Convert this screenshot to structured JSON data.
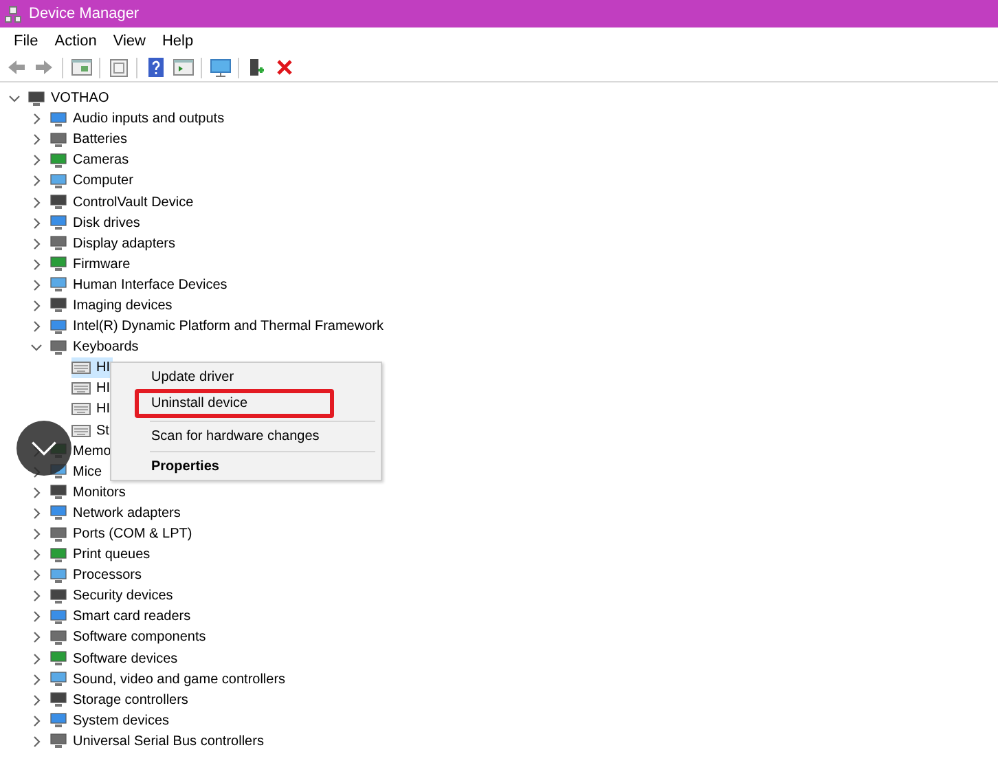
{
  "window": {
    "title": "Device Manager"
  },
  "menu": [
    "File",
    "Action",
    "View",
    "Help"
  ],
  "tree": {
    "label": "VOTHAO",
    "expanded": true,
    "selected": false,
    "children": [
      {
        "label": "Audio inputs and outputs",
        "expanded": false,
        "selected": false
      },
      {
        "label": "Batteries",
        "expanded": false,
        "selected": false
      },
      {
        "label": "Cameras",
        "expanded": false,
        "selected": false
      },
      {
        "label": "Computer",
        "expanded": false,
        "selected": false
      },
      {
        "label": "ControlVault Device",
        "expanded": false,
        "selected": false
      },
      {
        "label": "Disk drives",
        "expanded": false,
        "selected": false
      },
      {
        "label": "Display adapters",
        "expanded": false,
        "selected": false
      },
      {
        "label": "Firmware",
        "expanded": false,
        "selected": false
      },
      {
        "label": "Human Interface Devices",
        "expanded": false,
        "selected": false
      },
      {
        "label": "Imaging devices",
        "expanded": false,
        "selected": false
      },
      {
        "label": "Intel(R) Dynamic Platform and Thermal Framework",
        "expanded": false,
        "selected": false
      },
      {
        "label": "Keyboards",
        "expanded": true,
        "selected": false,
        "children": [
          {
            "label": "HI",
            "selected": true
          },
          {
            "label": "HI",
            "selected": false
          },
          {
            "label": "HI",
            "selected": false
          },
          {
            "label": "St",
            "selected": false
          }
        ]
      },
      {
        "label": "Memo",
        "expanded": false,
        "selected": false
      },
      {
        "label": "Mice",
        "expanded": false,
        "selected": false
      },
      {
        "label": "Monitors",
        "expanded": false,
        "selected": false
      },
      {
        "label": "Network adapters",
        "expanded": false,
        "selected": false
      },
      {
        "label": "Ports (COM & LPT)",
        "expanded": false,
        "selected": false
      },
      {
        "label": "Print queues",
        "expanded": false,
        "selected": false
      },
      {
        "label": "Processors",
        "expanded": false,
        "selected": false
      },
      {
        "label": "Security devices",
        "expanded": false,
        "selected": false
      },
      {
        "label": "Smart card readers",
        "expanded": false,
        "selected": false
      },
      {
        "label": "Software components",
        "expanded": false,
        "selected": false
      },
      {
        "label": "Software devices",
        "expanded": false,
        "selected": false
      },
      {
        "label": "Sound, video and game controllers",
        "expanded": false,
        "selected": false
      },
      {
        "label": "Storage controllers",
        "expanded": false,
        "selected": false
      },
      {
        "label": "System devices",
        "expanded": false,
        "selected": false
      },
      {
        "label": "Universal Serial Bus controllers",
        "expanded": false,
        "selected": false
      }
    ]
  },
  "context_menu": [
    {
      "label": "Update driver",
      "kind": "item",
      "bold": false,
      "annotated": false
    },
    {
      "label": "Uninstall device",
      "kind": "item",
      "bold": false,
      "annotated": true
    },
    {
      "kind": "separator"
    },
    {
      "label": "Scan for hardware changes",
      "kind": "item",
      "bold": false,
      "annotated": false
    },
    {
      "kind": "separator"
    },
    {
      "label": "Properties",
      "kind": "item",
      "bold": true,
      "annotated": false
    }
  ]
}
